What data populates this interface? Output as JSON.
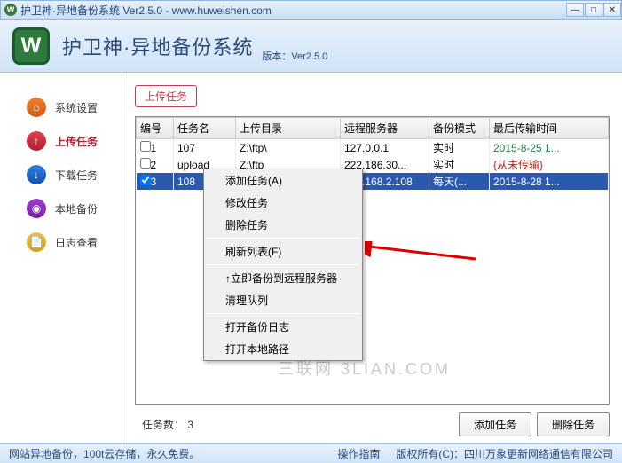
{
  "titlebar": {
    "text": "护卫神·异地备份系统 Ver2.5.0 - www.huweishen.com"
  },
  "header": {
    "title": "护卫神·异地备份系统",
    "version": "版本：Ver2.5.0"
  },
  "sidebar": {
    "items": [
      {
        "label": "系统设置"
      },
      {
        "label": "上传任务"
      },
      {
        "label": "下载任务"
      },
      {
        "label": "本地备份"
      },
      {
        "label": "日志查看"
      }
    ]
  },
  "content": {
    "top_button": "上传任务",
    "columns": [
      "编号",
      "任务名",
      "上传目录",
      "远程服务器",
      "备份模式",
      "最后传输时间"
    ],
    "rows": [
      {
        "checked": false,
        "id": "1",
        "name": "107",
        "dir": "Z:\\ftp\\",
        "server": "127.0.0.1",
        "mode": "实时",
        "time": "2015-8-25 1...",
        "time_class": "green-text"
      },
      {
        "checked": false,
        "id": "2",
        "name": "upload",
        "dir": "Z:\\ftp",
        "server": "222.186.30...",
        "mode": "实时",
        "time": "{从未传输}",
        "time_class": "red-text"
      },
      {
        "checked": true,
        "id": "3",
        "name": "108",
        "dir": "",
        "server": "192.168.2.108",
        "mode": "每天(...",
        "time": "2015-8-28 1...",
        "time_class": ""
      }
    ],
    "task_count_label": "任务数：",
    "task_count": "3",
    "add_button": "添加任务",
    "del_button": "删除任务"
  },
  "context_menu": {
    "items": [
      {
        "label": "添加任务(A)"
      },
      {
        "label": "修改任务"
      },
      {
        "label": "删除任务"
      },
      {
        "sep": true
      },
      {
        "label": "刷新列表(F)"
      },
      {
        "sep": true
      },
      {
        "label": "↑立即备份到远程服务器"
      },
      {
        "label": "清理队列"
      },
      {
        "sep": true
      },
      {
        "label": "打开备份日志"
      },
      {
        "label": "打开本地路径"
      }
    ]
  },
  "footer": {
    "left": "网站异地备份，100t云存储，永久免费。",
    "mid": "操作指南",
    "right": "版权所有(C)：四川万象更新网络通信有限公司"
  },
  "watermark": "三联网 3LIAN.COM"
}
